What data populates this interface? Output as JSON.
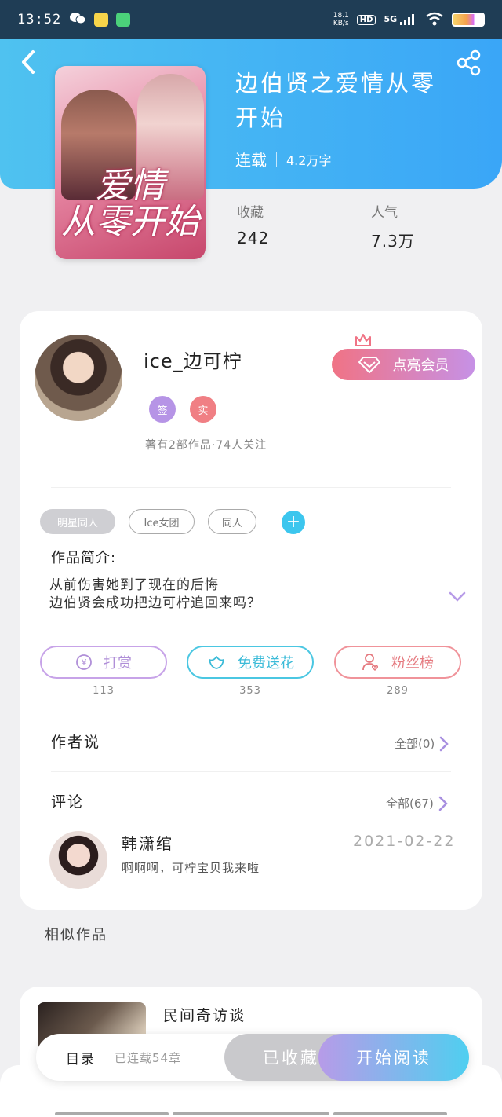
{
  "status_bar": {
    "time": "13:52",
    "net_speed": "18.1",
    "net_unit": "KB/s",
    "hd": "HD",
    "signal": "5G"
  },
  "book": {
    "cover_text": "爱情\n从零开始",
    "title": "边伯贤之爱情从零开始",
    "status": "连载",
    "word_count": "4.2万字",
    "collect_label": "收藏",
    "collect_value": "242",
    "popularity_label": "人气",
    "popularity_value": "7.3万"
  },
  "author": {
    "name": "ice_边可柠",
    "badge_sign": "签",
    "badge_real": "实",
    "stats": "著有2部作品·74人关注",
    "vip_button": "点亮会员"
  },
  "tags": [
    "明星同人",
    "Ice女团",
    "同人"
  ],
  "intro": {
    "label": "作品简介:",
    "line1": "从前伤害她到了现在的后悔",
    "line2": "边伯贤会成功把边可柠追回来吗？"
  },
  "actions": {
    "reward_label": "打赏",
    "reward_count": "113",
    "flower_label": "免费送花",
    "flower_count": "353",
    "fans_label": "粉丝榜",
    "fans_count": "289"
  },
  "author_says": {
    "title": "作者说",
    "more": "全部(0)"
  },
  "comments": {
    "title": "评论",
    "more": "全部(67)",
    "items": [
      {
        "name": "韩潇绾",
        "date": "2021-02-22",
        "text": "啊啊啊，可柠宝贝我来啦"
      }
    ]
  },
  "similar": {
    "label": "相似作品",
    "items": [
      {
        "title": "民间奇访谈"
      }
    ]
  },
  "bottom_bar": {
    "toc": "目录",
    "chapters": "已连载54章",
    "collected": "已收藏",
    "read": "开始阅读"
  },
  "colors": {
    "header_blue": "#3aa6f7",
    "vip_pink": "#f07385",
    "vip_purple": "#c691e6",
    "teal": "#3cc6ee"
  }
}
